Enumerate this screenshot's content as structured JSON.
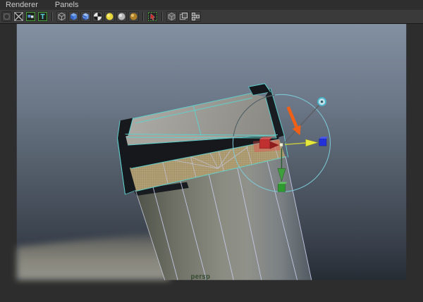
{
  "menu": {
    "items": [
      {
        "label": "Renderer"
      },
      {
        "label": "Panels"
      }
    ]
  },
  "toolbar": {
    "groups": [
      {
        "icons": [
          {
            "name": "camera-select"
          },
          {
            "name": "film-gate"
          },
          {
            "name": "resolution-gate"
          },
          {
            "name": "safe-title"
          }
        ]
      },
      {
        "icons": [
          {
            "name": "wireframe-cube"
          },
          {
            "name": "shaded-cube"
          },
          {
            "name": "textured-cube"
          },
          {
            "name": "default-material"
          },
          {
            "name": "lighting-all-lights"
          },
          {
            "name": "lighting-flat"
          },
          {
            "name": "lighting-default"
          }
        ]
      },
      {
        "icons": [
          {
            "name": "isolate-select"
          }
        ]
      },
      {
        "icons": [
          {
            "name": "xray-cube"
          },
          {
            "name": "wireframe-on-shaded"
          },
          {
            "name": "share-view"
          }
        ]
      }
    ]
  },
  "viewport": {
    "camera_label": "persp",
    "tool": "move-manipulator",
    "colors": {
      "viewport_top": "#8290a1",
      "viewport_bottom": "#272d35",
      "ground": "#8f8e86",
      "selection_wire_cyan": "#5ed2cf",
      "body_wire_lavender": "#c6cae8",
      "selected_faces_tan": "#b2a178",
      "axis_x_red": "#c03030",
      "axis_y_green": "#3f9f3f",
      "axis_z_blue": "#2431d8",
      "active_axis_yellow": "#e6e83c",
      "soft_select_circle": "#7dcdda",
      "annotation_orange": "#ee6018",
      "camera_label_text": "#344a31"
    }
  }
}
